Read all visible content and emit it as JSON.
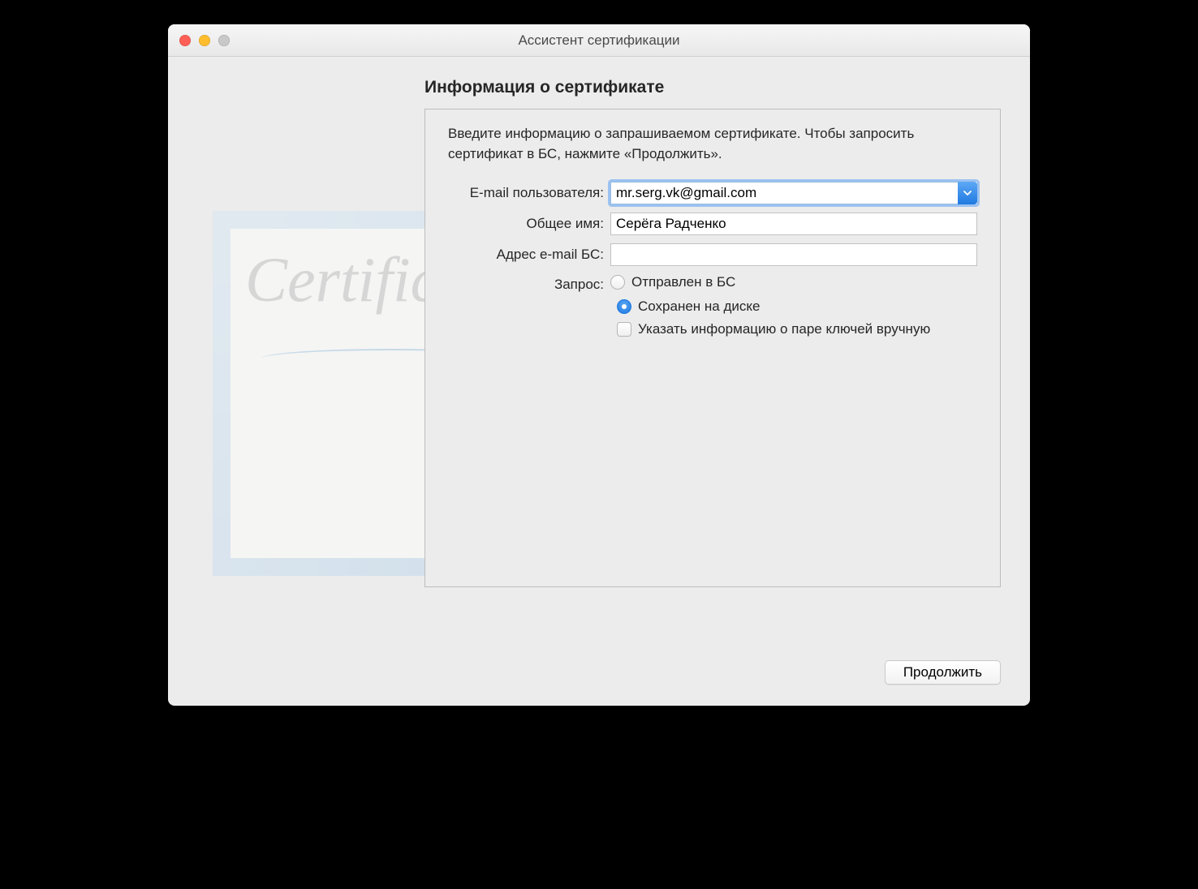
{
  "window": {
    "title": "Ассистент сертификации"
  },
  "heading": "Информация о сертификате",
  "instruction": "Введите информацию о запрашиваемом сертификате. Чтобы запросить сертификат в БС, нажмите «Продолжить».",
  "form": {
    "email_user": {
      "label": "E-mail пользователя:",
      "value": "mr.serg.vk@gmail.com"
    },
    "common_name": {
      "label": "Общее имя:",
      "value": "Серёга Радченко"
    },
    "ca_email": {
      "label": "Адрес e-mail БС:",
      "value": ""
    },
    "request": {
      "label": "Запрос:",
      "option_sent": "Отправлен в БС",
      "option_saved": "Сохранен на диске",
      "selected": "saved"
    },
    "keypair_checkbox": {
      "label": "Указать информацию о паре ключей вручную",
      "checked": false
    }
  },
  "certificate_watermark": "Certificate",
  "footer": {
    "continue_label": "Продолжить"
  }
}
